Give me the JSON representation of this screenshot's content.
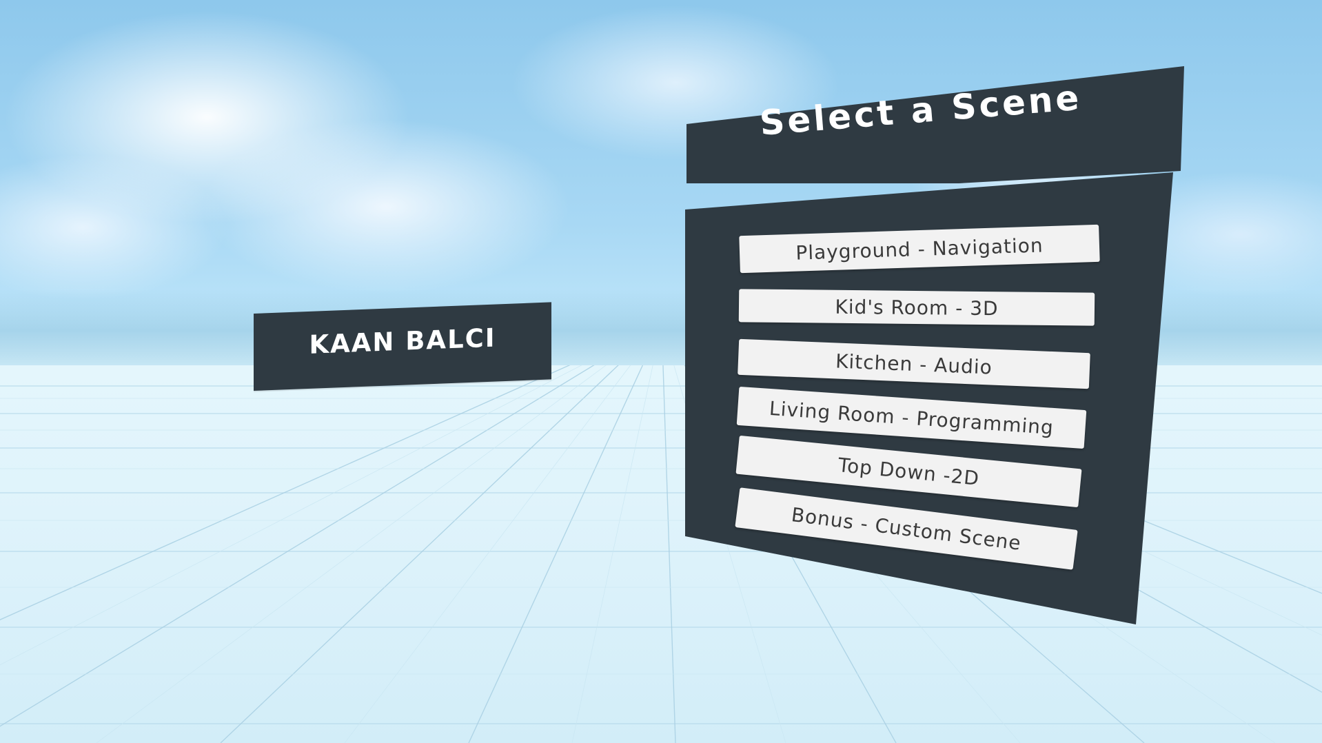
{
  "name_panel": {
    "label": "KAAN BALCI"
  },
  "scene_menu": {
    "title": "Select a Scene",
    "buttons": [
      {
        "label": "Playground - Navigation"
      },
      {
        "label": "Kid's Room - 3D"
      },
      {
        "label": "Kitchen - Audio"
      },
      {
        "label": "Living Room - Programming"
      },
      {
        "label": "Top Down -2D"
      },
      {
        "label": "Bonus - Custom Scene"
      }
    ]
  },
  "colors": {
    "panel": "#2f3a42",
    "button_bg": "#f2f2f2",
    "button_text": "#3a3a3a",
    "panel_text": "#ffffff",
    "sky": "#a8d8f4",
    "floor": "#e4f6fc"
  }
}
